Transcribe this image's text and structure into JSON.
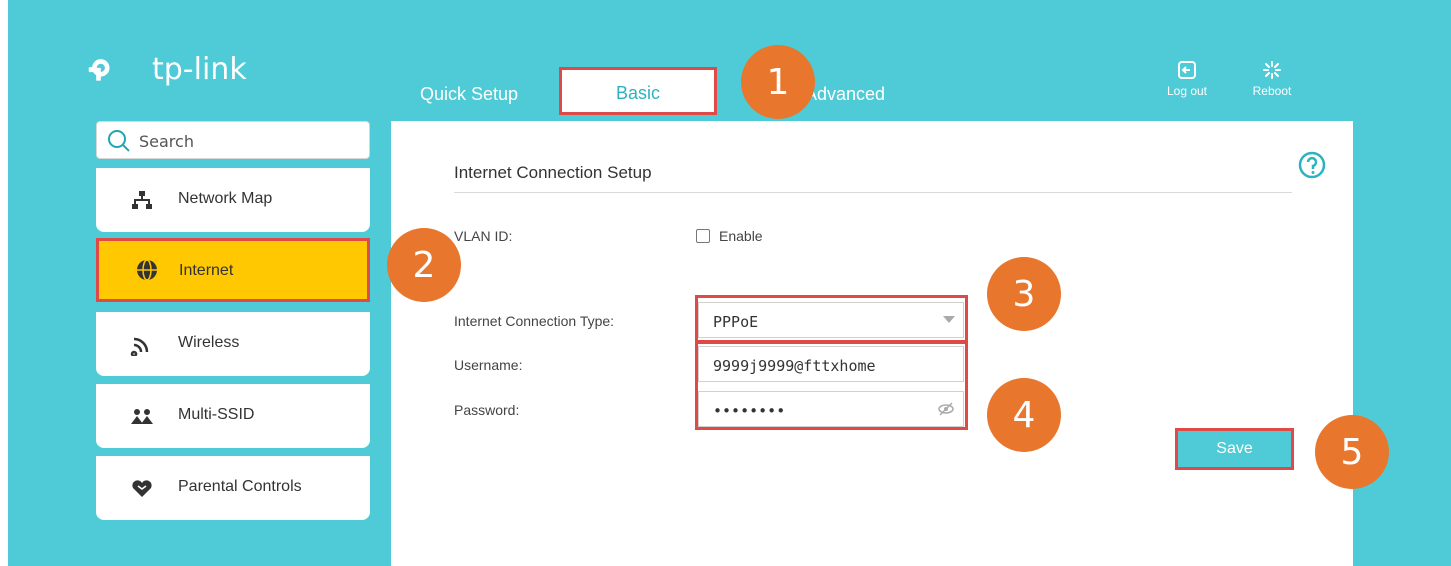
{
  "brand": {
    "logo_text": "tp-link"
  },
  "tabs": {
    "quick_setup": "Quick Setup",
    "basic": "Basic",
    "advanced": "Advanced"
  },
  "top_actions": {
    "logout": "Log out",
    "reboot": "Reboot"
  },
  "search": {
    "placeholder": "Search"
  },
  "sidebar": {
    "items": [
      {
        "label": "Network Map",
        "icon": "network-map-icon"
      },
      {
        "label": "Internet",
        "icon": "globe-icon",
        "active": true
      },
      {
        "label": "Wireless",
        "icon": "wireless-icon"
      },
      {
        "label": "Multi-SSID",
        "icon": "multi-ssid-icon"
      },
      {
        "label": "Parental Controls",
        "icon": "heart-icon"
      }
    ]
  },
  "section": {
    "title": "Internet Connection Setup"
  },
  "form": {
    "vlan_label": "VLAN ID:",
    "vlan_enable_label": "Enable",
    "connection_type_label": "Internet Connection Type:",
    "connection_type_value": "PPPoE",
    "username_label": "Username:",
    "username_value": "9999j9999@fttxhome",
    "password_label": "Password:",
    "password_value": "••••••••",
    "save_label": "Save"
  },
  "badges": [
    "1",
    "2",
    "3",
    "4",
    "5"
  ],
  "colors": {
    "brand": "#4ecbd6",
    "highlight": "#e04a46",
    "badge": "#e8762c",
    "active": "#ffc800"
  }
}
